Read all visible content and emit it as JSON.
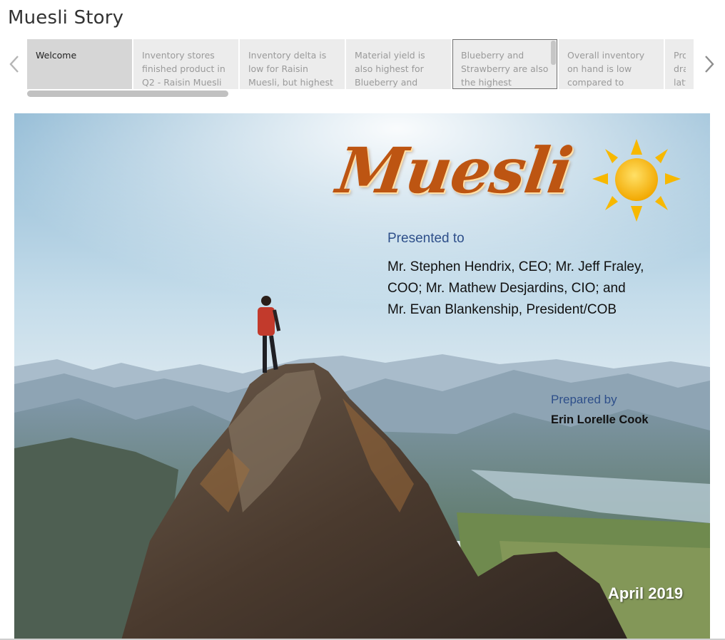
{
  "story": {
    "title": "Muesli Story"
  },
  "nav": {
    "prev_icon": "chevron-left-icon",
    "next_icon": "chevron-right-icon"
  },
  "story_points": [
    {
      "label": "Welcome",
      "state": "active"
    },
    {
      "label": "Inventory stores finished product in Q2 - Raisin Muesli",
      "state": "normal"
    },
    {
      "label": "Inventory delta is low for Raisin Muesli, but highest",
      "state": "normal"
    },
    {
      "label": "Material yield is also highest for Blueberry and",
      "state": "normal"
    },
    {
      "label": "Blueberry and Strawberry are also the highest",
      "state": "hover"
    },
    {
      "label": "Overall inventory on hand is low compared to",
      "state": "normal"
    },
    {
      "label": "Production drastically latter",
      "state": "normal"
    }
  ],
  "slide": {
    "logo_text": "Muesli",
    "logo_icon": "sun-icon",
    "presented_label": "Presented to",
    "presented_lines": [
      "Mr. Stephen Hendrix, CEO; Mr. Jeff Fraley,",
      "COO; Mr. Mathew Desjardins, CIO; and",
      "Mr. Evan Blankenship, President/COB"
    ],
    "prepared_label": "Prepared by",
    "prepared_name": "Erin Lorelle Cook",
    "date": "April 2019"
  },
  "colors": {
    "logo": "#bd5512",
    "label_blue": "#2e4f8a",
    "active_point": "#d6d6d6",
    "inactive_point": "#ececec"
  }
}
